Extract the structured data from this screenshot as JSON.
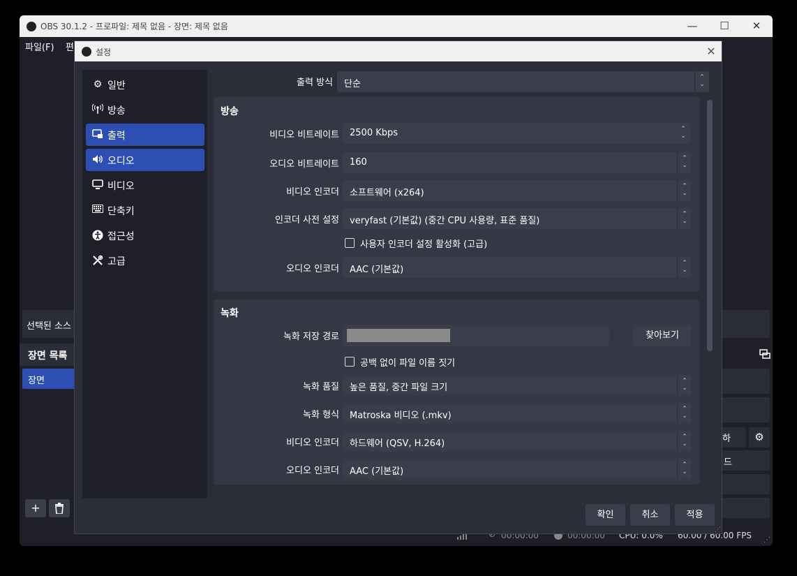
{
  "main_window": {
    "title": "OBS 30.1.2 - 프로파일: 제목 없음 - 장면: 제목 없음",
    "menu": [
      "파일(F)",
      "편"
    ],
    "selected_source_label": "선택된 소스",
    "scene_panel_title": "장면 목록",
    "scenes": [
      "장면"
    ],
    "right_partial": [
      "하",
      "드"
    ],
    "status": {
      "drop_time_1": "00:00:00",
      "drop_time_2": "00:00:00",
      "cpu": "CPU: 0.0%",
      "fps": "60.00 / 60.00 FPS"
    }
  },
  "dialog": {
    "title": "설정",
    "sidebar": [
      {
        "label": "일반",
        "icon": "gear-icon",
        "active": false
      },
      {
        "label": "방송",
        "icon": "antenna-icon",
        "active": false
      },
      {
        "label": "출력",
        "icon": "output-icon",
        "active": true
      },
      {
        "label": "오디오",
        "icon": "speaker-icon",
        "active": true
      },
      {
        "label": "비디오",
        "icon": "monitor-icon",
        "active": false
      },
      {
        "label": "단축키",
        "icon": "keyboard-icon",
        "active": false
      },
      {
        "label": "접근성",
        "icon": "accessibility-icon",
        "active": false
      },
      {
        "label": "고급",
        "icon": "tools-icon",
        "active": false
      }
    ],
    "output_mode_label": "출력 방식",
    "output_mode_value": "단순",
    "streaming": {
      "title": "방송",
      "video_bitrate_label": "비디오 비트레이트",
      "video_bitrate_value": "2500 Kbps",
      "audio_bitrate_label": "오디오 비트레이트",
      "audio_bitrate_value": "160",
      "video_encoder_label": "비디오 인코더",
      "video_encoder_value": "소프트웨어 (x264)",
      "encoder_preset_label": "인코더 사전 설정",
      "encoder_preset_value": "veryfast (기본값) (중간 CPU 사용량, 표준 품질)",
      "custom_encoder_check_label": "사용자 인코더 설정 활성화 (고급)",
      "audio_encoder_label": "오디오 인코더",
      "audio_encoder_value": "AAC (기본값)"
    },
    "recording": {
      "title": "녹화",
      "path_label": "녹화 저장 경로",
      "browse_label": "찾아보기",
      "no_space_check_label": "공백 없이 파일 이름 짓기",
      "quality_label": "녹화 품질",
      "quality_value": "높은 품질, 중간 파일 크기",
      "format_label": "녹화 형식",
      "format_value": "Matroska 비디오 (.mkv)",
      "video_encoder_label": "비디오 인코더",
      "video_encoder_value": "하드웨어 (QSV, H.264)",
      "audio_encoder_label": "오디오 인코더",
      "audio_encoder_value": "AAC (기본값)"
    },
    "buttons": {
      "ok": "확인",
      "cancel": "취소",
      "apply": "적용"
    }
  }
}
